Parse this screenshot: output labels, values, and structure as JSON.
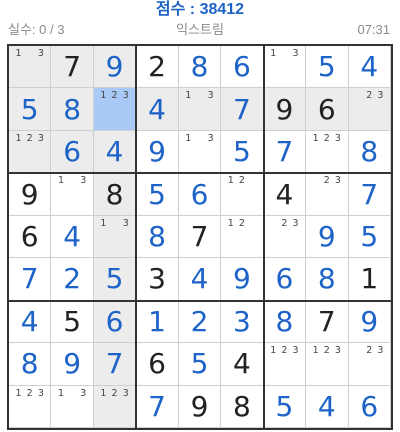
{
  "header": {
    "score_label": "점수 : 38412",
    "mistakes_label": "실수: 0 / 3",
    "difficulty_label": "익스트림",
    "timer_label": "07:31"
  },
  "board": {
    "selected": [
      1,
      2
    ],
    "highlight": [
      [
        0,
        0
      ],
      [
        0,
        1
      ],
      [
        0,
        2
      ],
      [
        1,
        0
      ],
      [
        1,
        1
      ],
      [
        1,
        2
      ],
      [
        2,
        0
      ],
      [
        2,
        1
      ],
      [
        2,
        2
      ],
      [
        1,
        3
      ],
      [
        1,
        4
      ],
      [
        1,
        5
      ],
      [
        1,
        6
      ],
      [
        1,
        7
      ],
      [
        1,
        8
      ],
      [
        0,
        2
      ],
      [
        2,
        2
      ],
      [
        3,
        2
      ],
      [
        4,
        2
      ],
      [
        5,
        2
      ],
      [
        6,
        2
      ],
      [
        7,
        2
      ],
      [
        8,
        2
      ]
    ],
    "cells": [
      [
        {
          "n": [
            1,
            3
          ]
        },
        {
          "v": 7,
          "g": 1
        },
        {
          "v": 9,
          "g": 0
        },
        {
          "v": 2,
          "g": 1
        },
        {
          "v": 8,
          "g": 0
        },
        {
          "v": 6,
          "g": 0
        },
        {
          "n": [
            1,
            3
          ]
        },
        {
          "v": 5,
          "g": 0
        },
        {
          "v": 4,
          "g": 0
        }
      ],
      [
        {
          "v": 5,
          "g": 0
        },
        {
          "v": 8,
          "g": 0
        },
        {
          "n": [
            1,
            2,
            3
          ]
        },
        {
          "v": 4,
          "g": 0
        },
        {
          "n": [
            1,
            3
          ]
        },
        {
          "v": 7,
          "g": 0
        },
        {
          "v": 9,
          "g": 1
        },
        {
          "v": 6,
          "g": 1
        },
        {
          "n": [
            2,
            3
          ]
        }
      ],
      [
        {
          "n": [
            1,
            2,
            3
          ]
        },
        {
          "v": 6,
          "g": 0
        },
        {
          "v": 4,
          "g": 0
        },
        {
          "v": 9,
          "g": 0
        },
        {
          "n": [
            1,
            3
          ]
        },
        {
          "v": 5,
          "g": 0
        },
        {
          "v": 7,
          "g": 0
        },
        {
          "n": [
            1,
            2,
            3
          ]
        },
        {
          "v": 8,
          "g": 0
        }
      ],
      [
        {
          "v": 9,
          "g": 1
        },
        {
          "n": [
            1,
            3
          ]
        },
        {
          "v": 8,
          "g": 1
        },
        {
          "v": 5,
          "g": 0
        },
        {
          "v": 6,
          "g": 0
        },
        {
          "n": [
            1,
            2
          ]
        },
        {
          "v": 4,
          "g": 1
        },
        {
          "n": [
            2,
            3
          ]
        },
        {
          "v": 7,
          "g": 0
        }
      ],
      [
        {
          "v": 6,
          "g": 1
        },
        {
          "v": 4,
          "g": 0
        },
        {
          "n": [
            1,
            3
          ]
        },
        {
          "v": 8,
          "g": 0
        },
        {
          "v": 7,
          "g": 1
        },
        {
          "n": [
            1,
            2
          ]
        },
        {
          "n": [
            2,
            3
          ]
        },
        {
          "v": 9,
          "g": 0
        },
        {
          "v": 5,
          "g": 0
        }
      ],
      [
        {
          "v": 7,
          "g": 0
        },
        {
          "v": 2,
          "g": 0
        },
        {
          "v": 5,
          "g": 0
        },
        {
          "v": 3,
          "g": 1
        },
        {
          "v": 4,
          "g": 0
        },
        {
          "v": 9,
          "g": 0
        },
        {
          "v": 6,
          "g": 0
        },
        {
          "v": 8,
          "g": 0
        },
        {
          "v": 1,
          "g": 1
        }
      ],
      [
        {
          "v": 4,
          "g": 0
        },
        {
          "v": 5,
          "g": 1
        },
        {
          "v": 6,
          "g": 0
        },
        {
          "v": 1,
          "g": 0
        },
        {
          "v": 2,
          "g": 0
        },
        {
          "v": 3,
          "g": 0
        },
        {
          "v": 8,
          "g": 0
        },
        {
          "v": 7,
          "g": 1
        },
        {
          "v": 9,
          "g": 0
        }
      ],
      [
        {
          "v": 8,
          "g": 0
        },
        {
          "v": 9,
          "g": 0
        },
        {
          "v": 7,
          "g": 0
        },
        {
          "v": 6,
          "g": 1
        },
        {
          "v": 5,
          "g": 0
        },
        {
          "v": 4,
          "g": 1
        },
        {
          "n": [
            1,
            2,
            3
          ]
        },
        {
          "n": [
            1,
            2,
            3
          ]
        },
        {
          "n": [
            2,
            3
          ]
        }
      ],
      [
        {
          "n": [
            1,
            2,
            3
          ]
        },
        {
          "n": [
            1,
            3
          ]
        },
        {
          "n": [
            1,
            2,
            3
          ]
        },
        {
          "v": 7,
          "g": 0
        },
        {
          "v": 9,
          "g": 1
        },
        {
          "v": 8,
          "g": 1
        },
        {
          "v": 5,
          "g": 0
        },
        {
          "v": 4,
          "g": 0
        },
        {
          "v": 6,
          "g": 0
        }
      ]
    ]
  }
}
